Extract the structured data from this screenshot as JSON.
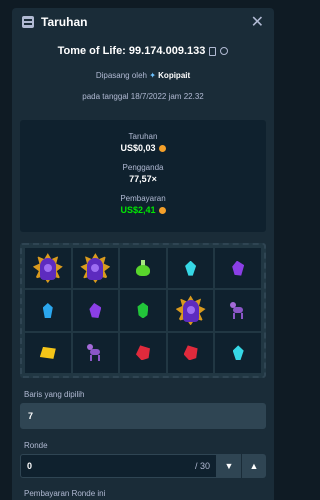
{
  "dialog": {
    "title": "Taruhan",
    "game_line": "Tome of Life: 99.174.009.133",
    "placed_prefix": "Dipasang oleh",
    "placed_user": "Kopipait",
    "date_line": "pada tanggal 18/7/2022 jam 22.32"
  },
  "stats": {
    "bet_label": "Taruhan",
    "bet_value": "US$0,03",
    "multiplier_label": "Pengganda",
    "multiplier_value": "77,57×",
    "payout_label": "Pembayaran",
    "payout_value": "US$2,41"
  },
  "reels": [
    [
      "wizard",
      "wizard",
      "potion",
      "gem-cyan",
      "gem-purple"
    ],
    [
      "gem-blue",
      "gem-purple",
      "gem-green",
      "wizard",
      "creature"
    ],
    [
      "gem-yellow",
      "creature",
      "gem-red",
      "gem-red",
      "gem-cyan"
    ]
  ],
  "lines": {
    "label": "Baris yang dipilih",
    "value": "7"
  },
  "round": {
    "label": "Ronde",
    "value": "0",
    "total": "/ 30"
  },
  "round_payout_label": "Pembayaran Ronde ini",
  "icons": {
    "header": "bet-slip-icon",
    "close": "close-icon",
    "copy": "copy-icon",
    "link": "link-icon",
    "user": "star-icon",
    "coin": "coin-icon",
    "down": "chevron-down-icon",
    "up": "chevron-up-icon"
  },
  "colors": {
    "background": "#1a2c38",
    "panel": "#0f212e",
    "accent_green": "#00e701",
    "coin": "#f4a02a"
  }
}
